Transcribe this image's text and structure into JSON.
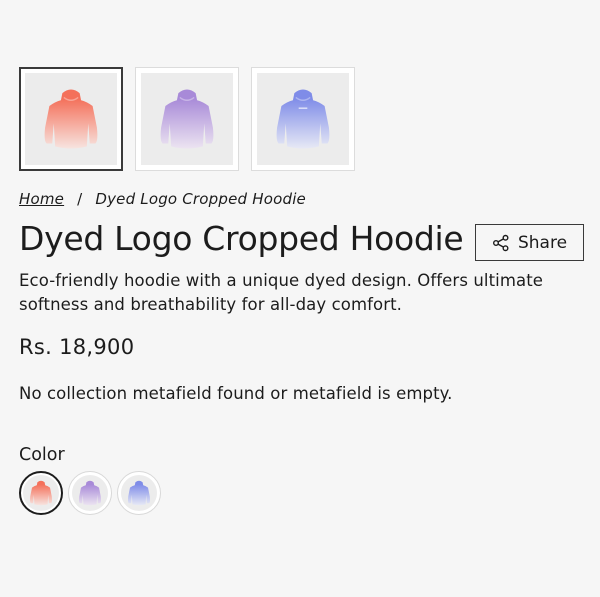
{
  "gallery": {
    "thumbnails": [
      {
        "color_top": "#f4705a",
        "color_bottom": "#f7e4e0",
        "selected": true
      },
      {
        "color_top": "#a88ad8",
        "color_bottom": "#ece4f1",
        "selected": false
      },
      {
        "color_top": "#7f8ce8",
        "color_bottom": "#e7e9f5",
        "selected": false
      }
    ]
  },
  "breadcrumb": {
    "home": "Home",
    "separator": "/",
    "current": "Dyed Logo Cropped Hoodie"
  },
  "product": {
    "title": "Dyed Logo Cropped Hoodie",
    "description": "Eco-friendly hoodie with a unique dyed design. Offers ultimate softness and breathability for all-day comfort.",
    "price": "Rs. 18,900",
    "metafield_message": "No collection metafield found or metafield is empty."
  },
  "share": {
    "label": "Share",
    "icon": "share-icon"
  },
  "color_option": {
    "label": "Color",
    "swatches": [
      {
        "color_top": "#f4705a",
        "color_bottom": "#f7e4e0",
        "selected": true
      },
      {
        "color_top": "#a88ad8",
        "color_bottom": "#ece4f1",
        "selected": false
      },
      {
        "color_top": "#7f8ce8",
        "color_bottom": "#e7e9f5",
        "selected": false
      }
    ]
  }
}
